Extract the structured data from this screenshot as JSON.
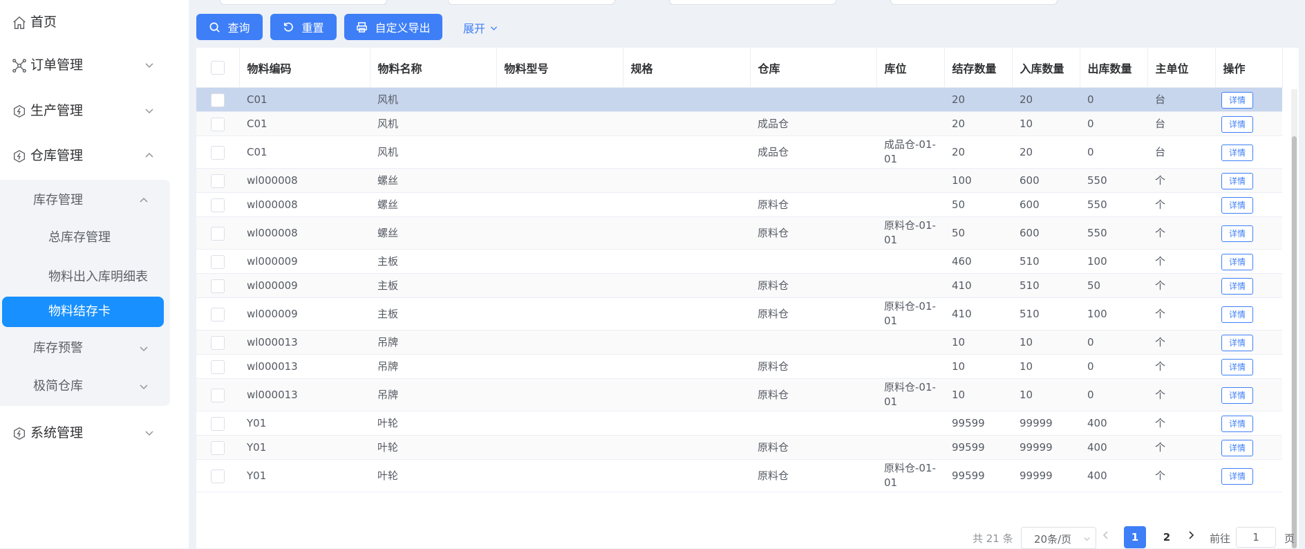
{
  "sidebar": {
    "home": "首页",
    "order": "订单管理",
    "production": "生产管理",
    "warehouse": "仓库管理",
    "inventory": "库存管理",
    "total_inventory": "总库存管理",
    "material_inout": "物料出入库明细表",
    "material_card": "物料结存卡",
    "inventory_warning": "库存预警",
    "simple_warehouse": "极简仓库",
    "system": "系统管理"
  },
  "toolbar": {
    "query": "查询",
    "reset": "重置",
    "export": "自定义导出",
    "expand": "展开"
  },
  "table": {
    "headers": [
      "物料编码",
      "物料名称",
      "物料型号",
      "规格",
      "仓库",
      "库位",
      "结存数量",
      "入库数量",
      "出库数量",
      "主单位",
      "操作"
    ],
    "action_label": "详情",
    "rows": [
      [
        "C01",
        "风机",
        "",
        "",
        "",
        "",
        "20",
        "20",
        "0",
        "台"
      ],
      [
        "C01",
        "风机",
        "",
        "",
        "成品仓",
        "",
        "20",
        "10",
        "0",
        "台"
      ],
      [
        "C01",
        "风机",
        "",
        "",
        "成品仓",
        "成品仓-01-01",
        "20",
        "20",
        "0",
        "台"
      ],
      [
        "wl000008",
        "螺丝",
        "",
        "",
        "",
        "",
        "100",
        "600",
        "550",
        "个"
      ],
      [
        "wl000008",
        "螺丝",
        "",
        "",
        "原料仓",
        "",
        "50",
        "600",
        "550",
        "个"
      ],
      [
        "wl000008",
        "螺丝",
        "",
        "",
        "原料仓",
        "原料仓-01-01",
        "50",
        "600",
        "550",
        "个"
      ],
      [
        "wl000009",
        "主板",
        "",
        "",
        "",
        "",
        "460",
        "510",
        "100",
        "个"
      ],
      [
        "wl000009",
        "主板",
        "",
        "",
        "原料仓",
        "",
        "410",
        "510",
        "50",
        "个"
      ],
      [
        "wl000009",
        "主板",
        "",
        "",
        "原料仓",
        "原料仓-01-01",
        "410",
        "510",
        "100",
        "个"
      ],
      [
        "wl000013",
        "吊牌",
        "",
        "",
        "",
        "",
        "10",
        "10",
        "0",
        "个"
      ],
      [
        "wl000013",
        "吊牌",
        "",
        "",
        "原料仓",
        "",
        "10",
        "10",
        "0",
        "个"
      ],
      [
        "wl000013",
        "吊牌",
        "",
        "",
        "原料仓",
        "原料仓-01-01",
        "10",
        "10",
        "0",
        "个"
      ],
      [
        "Y01",
        "叶轮",
        "",
        "",
        "",
        "",
        "99599",
        "99999",
        "400",
        "个"
      ],
      [
        "Y01",
        "叶轮",
        "",
        "",
        "原料仓",
        "",
        "99599",
        "99999",
        "400",
        "个"
      ],
      [
        "Y01",
        "叶轮",
        "",
        "",
        "原料仓",
        "原料仓-01-01",
        "99599",
        "99999",
        "400",
        "个"
      ]
    ]
  },
  "pagination": {
    "total": "共 21 条",
    "page_size": "20条/页",
    "current_page": "1",
    "page_2": "2",
    "goto_label": "前往",
    "goto_value": "1",
    "page_unit": "页"
  },
  "colors": {
    "primary": "#3e7ff7",
    "active_menu": "#1890ff",
    "selected_row": "#c7d6ed"
  }
}
